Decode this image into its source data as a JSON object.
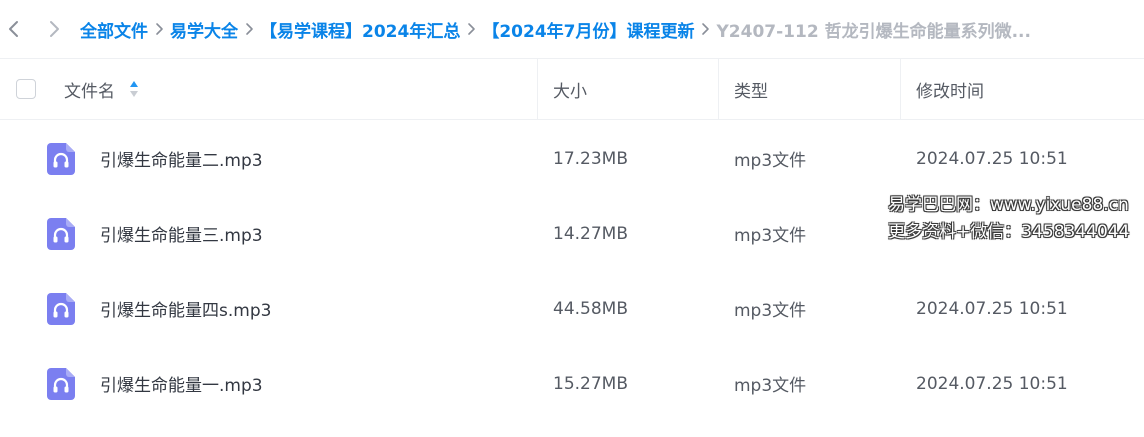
{
  "breadcrumb": {
    "items": [
      "全部文件",
      "易学大全",
      "【易学课程】2024年汇总",
      "【2024年7月份】课程更新"
    ],
    "current": "Y2407-112 哲龙引爆生命能量系列微..."
  },
  "table": {
    "headers": {
      "name": "文件名",
      "size": "大小",
      "type": "类型",
      "modified": "修改时间"
    },
    "rows": [
      {
        "name": "引爆生命能量二.mp3",
        "size": "17.23MB",
        "type": "mp3文件",
        "modified": "2024.07.25 10:51",
        "icon": "audio-file-icon"
      },
      {
        "name": "引爆生命能量三.mp3",
        "size": "14.27MB",
        "type": "mp3文件",
        "modified": "",
        "icon": "audio-file-icon"
      },
      {
        "name": "引爆生命能量四s.mp3",
        "size": "44.58MB",
        "type": "mp3文件",
        "modified": "2024.07.25 10:51",
        "icon": "audio-file-icon"
      },
      {
        "name": "引爆生命能量一.mp3",
        "size": "15.27MB",
        "type": "mp3文件",
        "modified": "2024.07.25 10:51",
        "icon": "audio-file-icon"
      }
    ]
  },
  "watermark": {
    "line1": "易学巴巴网：www.yixue88.cn",
    "line2": "更多资料+微信：3458344044"
  },
  "colors": {
    "link": "#0a84e8",
    "icon_accent": "#7b7ff0",
    "border": "#eef0f3"
  }
}
